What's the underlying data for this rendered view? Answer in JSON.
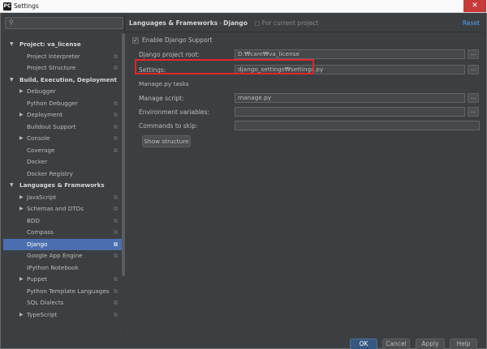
{
  "window": {
    "title": "Settings"
  },
  "sidebar": {
    "search_placeholder": "",
    "items": [
      {
        "label": "Project: va_license",
        "level": 0,
        "group": true,
        "expanded": true,
        "scope": false
      },
      {
        "label": "Project Interpreter",
        "level": 1,
        "scope": true
      },
      {
        "label": "Project Structure",
        "level": 1,
        "scope": true
      },
      {
        "label": "Build, Execution, Deployment",
        "level": 0,
        "group": true,
        "expanded": true,
        "scope": false
      },
      {
        "label": "Debugger",
        "level": 1,
        "collapsed": true,
        "scope": false
      },
      {
        "label": "Python Debugger",
        "level": 1,
        "scope": true
      },
      {
        "label": "Deployment",
        "level": 1,
        "collapsed": true,
        "scope": true
      },
      {
        "label": "Buildout Support",
        "level": 1,
        "scope": true
      },
      {
        "label": "Console",
        "level": 1,
        "collapsed": true,
        "scope": true
      },
      {
        "label": "Coverage",
        "level": 1,
        "scope": true
      },
      {
        "label": "Docker",
        "level": 1,
        "scope": false
      },
      {
        "label": "Docker Registry",
        "level": 1,
        "scope": false
      },
      {
        "label": "Languages & Frameworks",
        "level": 0,
        "group": true,
        "expanded": true,
        "scope": false
      },
      {
        "label": "JavaScript",
        "level": 1,
        "collapsed": true,
        "scope": true
      },
      {
        "label": "Schemas and DTDs",
        "level": 1,
        "collapsed": true,
        "scope": true
      },
      {
        "label": "BDD",
        "level": 1,
        "scope": true
      },
      {
        "label": "Compass",
        "level": 1,
        "scope": true
      },
      {
        "label": "Django",
        "level": 1,
        "scope": true,
        "selected": true
      },
      {
        "label": "Google App Engine",
        "level": 1,
        "scope": true
      },
      {
        "label": "IPython Notebook",
        "level": 1,
        "scope": false
      },
      {
        "label": "Puppet",
        "level": 1,
        "collapsed": true,
        "scope": true
      },
      {
        "label": "Python Template Languages",
        "level": 1,
        "scope": true
      },
      {
        "label": "SQL Dialects",
        "level": 1,
        "scope": true
      },
      {
        "label": "TypeScript",
        "level": 1,
        "collapsed": true,
        "scope": true
      }
    ]
  },
  "header": {
    "crumb_parent": "Languages & Frameworks",
    "separator": "›",
    "crumb_current": "Django",
    "scope_note": "For current project",
    "reset": "Reset"
  },
  "django": {
    "enable_label": "Enable Django Support",
    "enabled": true,
    "project_root_label": "Django project root:",
    "project_root_value": "D:₩cam₩va_license",
    "settings_label": "Settings:",
    "settings_value": "django_settings₩settings.py",
    "manage_section": "Manage.py tasks",
    "manage_script_label": "Manage script:",
    "manage_script_value": "manage.py",
    "env_vars_label": "Environment variables:",
    "env_vars_value": "",
    "commands_skip_label": "Commands to skip:",
    "commands_skip_value": "",
    "show_structure": "Show structure",
    "browse": "..."
  },
  "footer": {
    "ok": "OK",
    "cancel": "Cancel",
    "apply": "Apply",
    "help": "Help"
  },
  "colors": {
    "accent": "#4b6eaf",
    "link": "#589df6",
    "highlight": "#e0262b"
  }
}
